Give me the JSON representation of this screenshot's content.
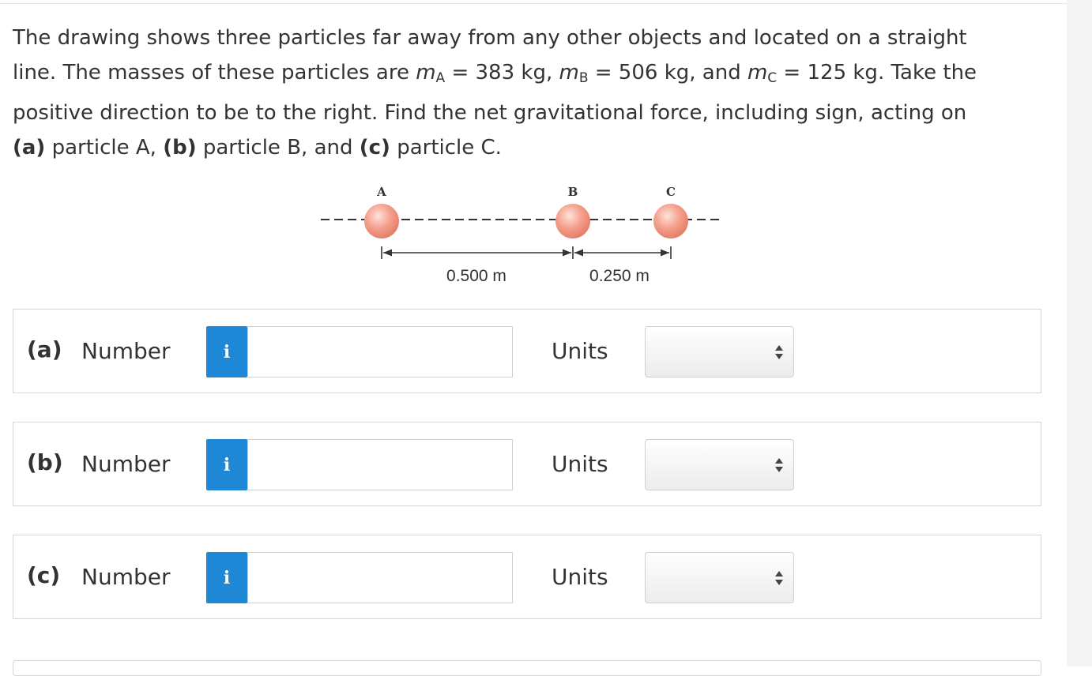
{
  "problem": {
    "line1": "The drawing shows three particles far away from any other objects and located on a straight",
    "line2_pre": "line. The masses of these particles are ",
    "m": "m",
    "sub_a": "A",
    "eq_a": " = 383 kg, ",
    "sub_b": "B",
    "eq_b": " = 506 kg, and ",
    "sub_c": "C",
    "eq_c": " = 125 kg. Take the",
    "line3": "positive direction to be to the right. Find the net gravitational force, including sign, acting on",
    "part_a": "(a)",
    "text_a": " particle A, ",
    "part_b": "(b)",
    "text_b": " particle B, and ",
    "part_c": "(c)",
    "text_c": " particle C."
  },
  "diagram": {
    "label_a": "A",
    "label_b": "B",
    "label_c": "C",
    "dist_ab": "0.500 m",
    "dist_bc": "0.250 m",
    "particle_color": "#f4a08c"
  },
  "answers": [
    {
      "part": "(a)",
      "number_label": "Number",
      "info": "i",
      "value": "",
      "units_label": "Units",
      "units_value": ""
    },
    {
      "part": "(b)",
      "number_label": "Number",
      "info": "i",
      "value": "",
      "units_label": "Units",
      "units_value": ""
    },
    {
      "part": "(c)",
      "number_label": "Number",
      "info": "i",
      "value": "",
      "units_label": "Units",
      "units_value": ""
    }
  ],
  "colors": {
    "info_button": "#1e88d6",
    "text": "#333333",
    "border": "#d6d6d6"
  }
}
